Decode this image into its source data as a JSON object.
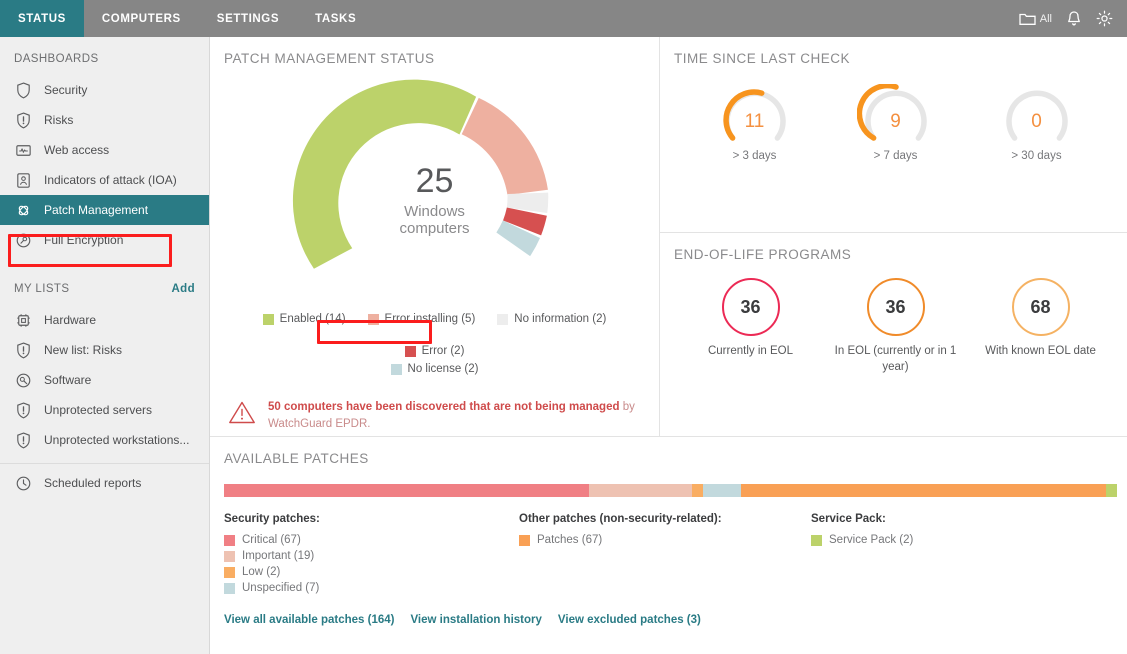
{
  "topbar": {
    "tabs": [
      {
        "label": "STATUS",
        "active": true
      },
      {
        "label": "COMPUTERS",
        "active": false
      },
      {
        "label": "SETTINGS",
        "active": false
      },
      {
        "label": "TASKS",
        "active": false
      }
    ],
    "all_label": "All",
    "icons": [
      "folder-icon",
      "bell-icon",
      "gear-icon"
    ]
  },
  "sidebar": {
    "dashboards_header": "DASHBOARDS",
    "dashboards": [
      {
        "label": "Security",
        "icon": "shield-icon"
      },
      {
        "label": "Risks",
        "icon": "alert-shield-icon"
      },
      {
        "label": "Web access",
        "icon": "web-access-icon"
      },
      {
        "label": "Indicators of attack (IOA)",
        "icon": "user-badge-icon"
      },
      {
        "label": "Patch Management",
        "icon": "patch-icon"
      },
      {
        "label": "Full Encryption",
        "icon": "encryption-icon"
      }
    ],
    "mylists_header": "MY LISTS",
    "add_label": "Add",
    "mylists": [
      {
        "label": "Hardware",
        "icon": "chip-icon"
      },
      {
        "label": "New list: Risks",
        "icon": "alert-shield-icon"
      },
      {
        "label": "Software",
        "icon": "software-icon"
      },
      {
        "label": "Unprotected servers",
        "icon": "alert-shield-icon"
      },
      {
        "label": "Unprotected workstations...",
        "icon": "alert-shield-icon"
      }
    ],
    "reports": {
      "label": "Scheduled reports",
      "icon": "clock-icon"
    }
  },
  "patch_status": {
    "title": "PATCH MANAGEMENT STATUS",
    "center_value": "25",
    "center_line1": "Windows",
    "center_line2": "computers"
  },
  "warning": {
    "icon": "warning-triangle-icon",
    "bold_text": "50 computers have been discovered that are not being managed",
    "normal_text": " by WatchGuard EPDR."
  },
  "time_since_check": {
    "title": "TIME SINCE LAST CHECK",
    "gauges": [
      {
        "value": "11",
        "label": "> 3 days",
        "pct": 70
      },
      {
        "value": "9",
        "label": "> 7 days",
        "pct": 57
      },
      {
        "value": "0",
        "label": "> 30 days",
        "pct": 0
      }
    ]
  },
  "eol": {
    "title": "END-OF-LIFE PROGRAMS",
    "items": [
      {
        "value": "36",
        "label": "Currently in EOL",
        "color": "#ec2a55"
      },
      {
        "value": "36",
        "label": "In EOL (currently or in 1 year)",
        "color": "#f08b2a"
      },
      {
        "value": "68",
        "label": "With known EOL date",
        "color": "#f5b263"
      }
    ]
  },
  "available_patches": {
    "title": "AVAILABLE PATCHES",
    "columns": [
      {
        "header": "Security patches:",
        "items": [
          {
            "label": "Critical (67)",
            "color": "#f07f84"
          },
          {
            "label": "Important (19)",
            "color": "#eec2b2"
          },
          {
            "label": "Low (2)",
            "color": "#f9ad62"
          },
          {
            "label": "Unspecified (7)",
            "color": "#c2d9dd"
          }
        ]
      },
      {
        "header": "Other patches (non-security-related):",
        "items": [
          {
            "label": "Patches (67)",
            "color": "#f9a055"
          }
        ]
      },
      {
        "header": "Service Pack:",
        "items": [
          {
            "label": "Service Pack (2)",
            "color": "#bcd26a"
          }
        ]
      }
    ],
    "links": [
      "View all available patches (164)",
      "View installation history",
      "View excluded patches (3)"
    ]
  },
  "chart_data": [
    {
      "type": "pie",
      "title": "PATCH MANAGEMENT STATUS",
      "subtitle": "25 Windows computers",
      "categories": [
        "Enabled",
        "Error installing",
        "No information",
        "Error",
        "No license"
      ],
      "values": [
        14,
        5,
        2,
        2,
        2
      ],
      "labels": [
        "Enabled (14)",
        "Error installing (5)",
        "No information (2)",
        "Error (2)",
        "No license (2)"
      ],
      "colors": [
        "#bcd26a",
        "#eeb0a0",
        "#ededed",
        "#d65050",
        "#c2d9dd"
      ],
      "total": 25,
      "legend": "bottom",
      "note": "semi-donut gauge, open at bottom"
    },
    {
      "type": "bar",
      "title": "TIME SINCE LAST CHECK",
      "categories": [
        "> 3 days",
        "> 7 days",
        "> 30 days"
      ],
      "values": [
        11,
        9,
        0
      ],
      "colors": [
        "#f7941e",
        "#f7941e",
        "#f7941e"
      ],
      "note": "radial gauges"
    },
    {
      "type": "bar",
      "title": "END-OF-LIFE PROGRAMS",
      "categories": [
        "Currently in EOL",
        "In EOL (currently or in 1 year)",
        "With known EOL date"
      ],
      "values": [
        36,
        36,
        68
      ],
      "colors": [
        "#ec2a55",
        "#f08b2a",
        "#f5b263"
      ],
      "note": "circular counters"
    },
    {
      "type": "bar",
      "title": "AVAILABLE PATCHES",
      "categories": [
        "Critical",
        "Important",
        "Low",
        "Unspecified",
        "Patches",
        "Service Pack"
      ],
      "values": [
        67,
        19,
        2,
        7,
        67,
        2
      ],
      "colors": [
        "#f07f84",
        "#eec2b2",
        "#f9ad62",
        "#c2d9dd",
        "#f9a055",
        "#bcd26a"
      ],
      "total": 164,
      "note": "single horizontal stacked bar"
    }
  ]
}
